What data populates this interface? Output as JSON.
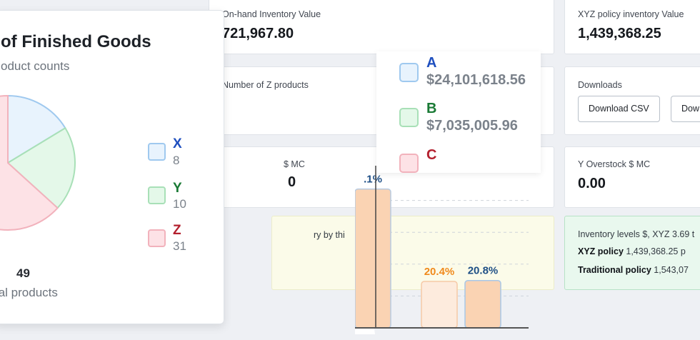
{
  "cards": {
    "onhand_label": "On-hand Inventory Value",
    "onhand_value": "721,967.80",
    "xyz_policy_label": "XYZ policy inventory Value",
    "xyz_policy_value": "1,439,368.25",
    "z_products_label": "Number of Z products",
    "downloads_label": "Downloads",
    "download_csv": "Download CSV",
    "download_second": "Dow",
    "mc_label": "$ MC",
    "mc_value": "0",
    "y_overstock_label": "Y Overstock $ MC",
    "y_overstock_value": "0.00",
    "yellow_note": "ry by thi",
    "green_line1": "Inventory levels $, XYZ 3.69 t",
    "green_line2_bold": "XYZ policy",
    "green_line2_rest": " 1,439,368.25 p",
    "green_line3_bold": "Traditional policy",
    "green_line3_rest": " 1,543,07"
  },
  "pie_card": {
    "title": "of Finished Goods",
    "subtitle": "oduct counts",
    "total_value": "49",
    "total_label": "tal products"
  },
  "chart_data": [
    {
      "type": "pie",
      "title": "of Finished Goods",
      "subtitle": "oduct counts",
      "categories": [
        "X",
        "Y",
        "Z"
      ],
      "values": [
        8,
        10,
        31
      ],
      "colors": {
        "X": {
          "fill": "#e8f3fd",
          "stroke": "#9fc9ef",
          "text": "#1f4fbf"
        },
        "Y": {
          "fill": "#e4f8e9",
          "stroke": "#a8e0b7",
          "text": "#1a7a35"
        },
        "Z": {
          "fill": "#fde2e6",
          "stroke": "#f2b2bc",
          "text": "#b3202e"
        }
      },
      "legend_position": "right"
    },
    {
      "type": "legend",
      "entries": [
        {
          "label": "A",
          "value": "$24,101,618.56",
          "fill": "#e8f3fd",
          "stroke": "#9fc9ef",
          "text": "#1f4fbf"
        },
        {
          "label": "B",
          "value": "$7,035,005.96",
          "fill": "#e4f8e9",
          "stroke": "#a8e0b7",
          "text": "#1a7a35"
        },
        {
          "label": "C",
          "value": "",
          "fill": "#fde2e6",
          "stroke": "#f2b2bc",
          "text": "#b3202e"
        }
      ]
    },
    {
      "type": "bar",
      "ylim": [
        0,
        70
      ],
      "bars": [
        {
          "value": 61,
          "label": ".1%",
          "fill": "#fad3b3",
          "stroke": "#b7cbe2",
          "label_color": "#1e4f86"
        },
        {
          "value": 20.4,
          "label": "20.4%",
          "fill": "#fdebdd",
          "stroke": "#f6c9a6",
          "label_color": "#f08a1c"
        },
        {
          "value": 20.8,
          "label": "20.8%",
          "fill": "#fad3b3",
          "stroke": "#a8c8e8",
          "label_color": "#1e4f86"
        }
      ],
      "grid": true
    }
  ]
}
